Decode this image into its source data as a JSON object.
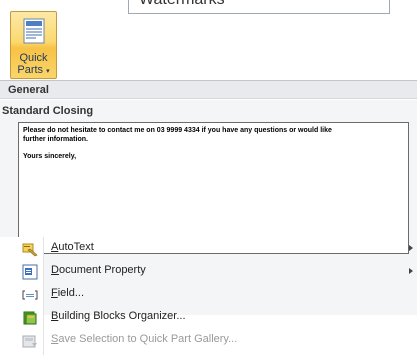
{
  "ribbon": {
    "watermarks_label": "Watermarks",
    "quick_parts_line1": "Quick",
    "quick_parts_line2": "Parts",
    "quick_parts_arrow": "▾"
  },
  "gallery": {
    "section_header": "General",
    "item_title": "Standard Closing",
    "preview_lines": [
      "Please do not hesitate to contact me on 03 9999 4334 if you have any questions or would like",
      "further information.",
      "Yours sincerely,"
    ]
  },
  "menu": {
    "items": [
      {
        "label": "AutoText",
        "mnemonic": "A",
        "rest": "utoText",
        "icon": "autotext-icon",
        "submenu": true,
        "disabled": false
      },
      {
        "label": "Document Property",
        "mnemonic": "D",
        "rest": "ocument Property",
        "icon": "document-property-icon",
        "submenu": true,
        "disabled": false
      },
      {
        "label": "Field...",
        "mnemonic": "F",
        "rest": "ield...",
        "icon": "field-icon",
        "submenu": false,
        "disabled": false
      },
      {
        "label": "Building Blocks Organizer...",
        "mnemonic": "B",
        "rest": "uilding Blocks Organizer...",
        "icon": "building-blocks-icon",
        "submenu": false,
        "disabled": false
      },
      {
        "label": "Save Selection to Quick Part Gallery...",
        "mnemonic": "S",
        "rest": "ave Selection to Quick Part Gallery...",
        "icon": "save-selection-icon",
        "submenu": false,
        "disabled": true
      }
    ]
  },
  "colors": {
    "button_highlight": "#fbd970",
    "section_header_bg": "#e8eaee",
    "gallery_bg": "#f4f5f7",
    "disabled_text": "#9a9a9a"
  }
}
